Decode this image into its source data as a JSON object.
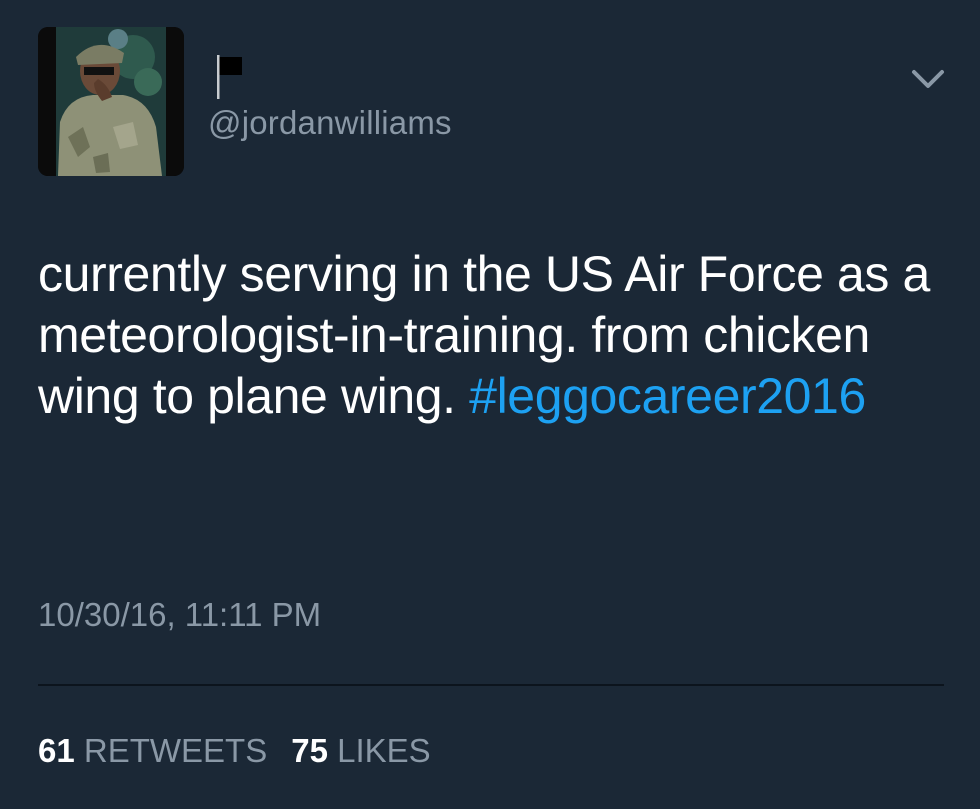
{
  "profile": {
    "flag_icon": "black-flag-icon",
    "handle": "@jordanwilliams",
    "menu_icon": "chevron-down-icon"
  },
  "tweet": {
    "text": "currently serving in the US Air Force as a meteorologist-in-training. from chicken wing to plane wing.",
    "hashtag": "#leggocareer2016",
    "timestamp": "10/30/16, 11:11 PM"
  },
  "stats": {
    "retweets_count": "61",
    "retweets_label": "RETWEETS",
    "likes_count": "75",
    "likes_label": "LIKES"
  },
  "colors": {
    "background": "#1b2836",
    "text": "#ffffff",
    "secondary": "#8a98a6",
    "link": "#1da1f2"
  }
}
